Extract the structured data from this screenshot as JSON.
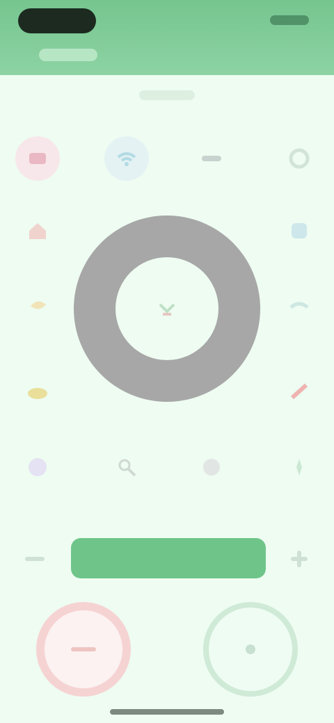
{
  "header": {
    "title": "",
    "subtitle": ""
  },
  "zoom": {
    "label": ""
  },
  "colors": {
    "header": "#76c58f",
    "accent": "#6fc589",
    "dial": "#a7a7a7",
    "background": "#eefcf2",
    "power": "#f6d3d3"
  },
  "icons": {
    "row1": [
      "input-source-icon",
      "wifi-icon",
      "menu-icon",
      "settings-icon"
    ],
    "row2_left": "home-icon",
    "row2_right": "apps-icon",
    "row3_left": "back-icon",
    "row3_right": "info-icon",
    "row4_left": "volume-icon",
    "row4_right": "favorite-icon",
    "row5": [
      "display-icon",
      "search-icon",
      "recent-icon",
      "guide-icon"
    ],
    "center": "ok-icon",
    "power": "power-icon",
    "mute": "mute-icon"
  }
}
